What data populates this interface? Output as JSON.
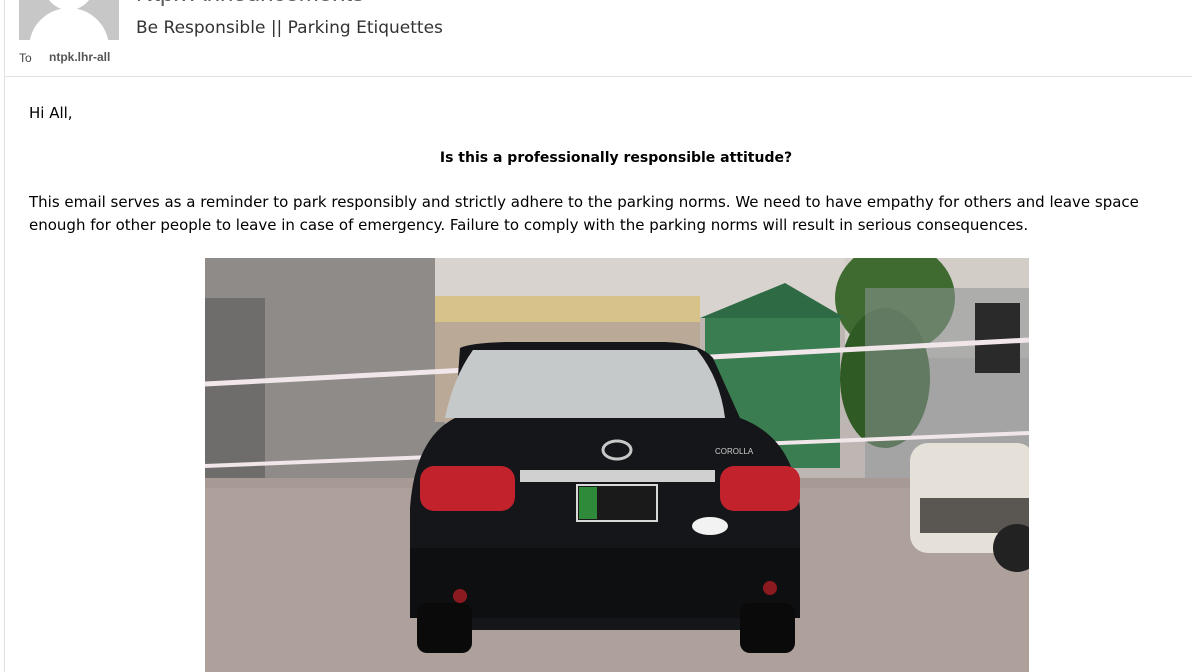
{
  "header": {
    "sender": "Ntpk Announcements",
    "subject": "Be Responsible || Parking Etiquettes",
    "to_label": "To",
    "to_value": "ntpk.lhr-all"
  },
  "body": {
    "greeting": "Hi All,",
    "question": "Is this a professionally responsible attitude?",
    "paragraph": "This email serves as a reminder to park responsibly and strictly adhere to the parking norms. We need to have empathy for others and leave space enough for other people to leave in case of emergency. Failure to comply with the parking norms will result in serious consequences."
  },
  "photo": {
    "car_model_badge": "COROLLA"
  },
  "colors": {
    "divider": "#e1e1e1",
    "avatar_bg": "#c7c7c7"
  }
}
